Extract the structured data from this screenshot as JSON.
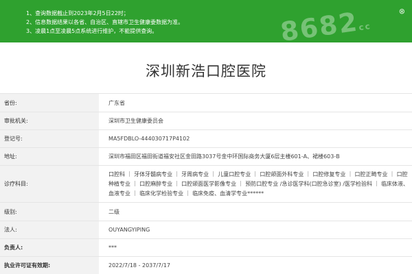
{
  "notice": {
    "lines": [
      "1、查询数据截止到2023年2月5日22时；",
      "2、信息数据结果以各省、自治区、直辖市卫生健康委数据为准。",
      "3、凌晨1点至凌晨5点系统进行维护，不能提供查询。"
    ],
    "watermark": "8682",
    "watermark_suffix": "cc",
    "close_glyph": "⊗"
  },
  "hospital": {
    "name": "深圳新浩口腔医院"
  },
  "fields": [
    {
      "label": "省份:",
      "value": "广东省"
    },
    {
      "label": "审批机关:",
      "value": "深圳市卫生健康委员会"
    },
    {
      "label": "登记号:",
      "value": "MA5FDBLO-444030717P4102"
    },
    {
      "label": "地址:",
      "value": "深圳市福田区福田街道福安社区金田路3037号金中环国际商务大厦6层主楼601-A、裙楼603-B"
    },
    {
      "label": "诊疗科目:",
      "value": "口腔科 ｜ 牙体牙髓病专业 ｜ 牙周病专业 ｜ 儿童口腔专业 ｜ 口腔颌面外科专业 ｜ 口腔修复专业 ｜ 口腔正畸专业 ｜ 口腔种植专业 ｜ 口腔麻醉专业 ｜ 口腔颌面医学影像专业 ｜ 预防口腔专业 /急诊医学科(口腔急诊室) /医学检验科 ｜ 临床体液、血液专业 ｜ 临床化学检验专业 ｜ 临床免疫、血清学专业******"
    },
    {
      "label": "级别:",
      "value": "二级"
    },
    {
      "label": "法人:",
      "value": "OUYANGYIPING"
    },
    {
      "label": "负责人:",
      "value": "***"
    },
    {
      "label": "执业许可证有效期:",
      "value": "2022/7/18 - 2037/7/17"
    }
  ],
  "colors": {
    "notice_bg": "#2fa12f",
    "label_bg": "#f2f2f2",
    "border": "#e5e5e5",
    "text": "#333333"
  }
}
